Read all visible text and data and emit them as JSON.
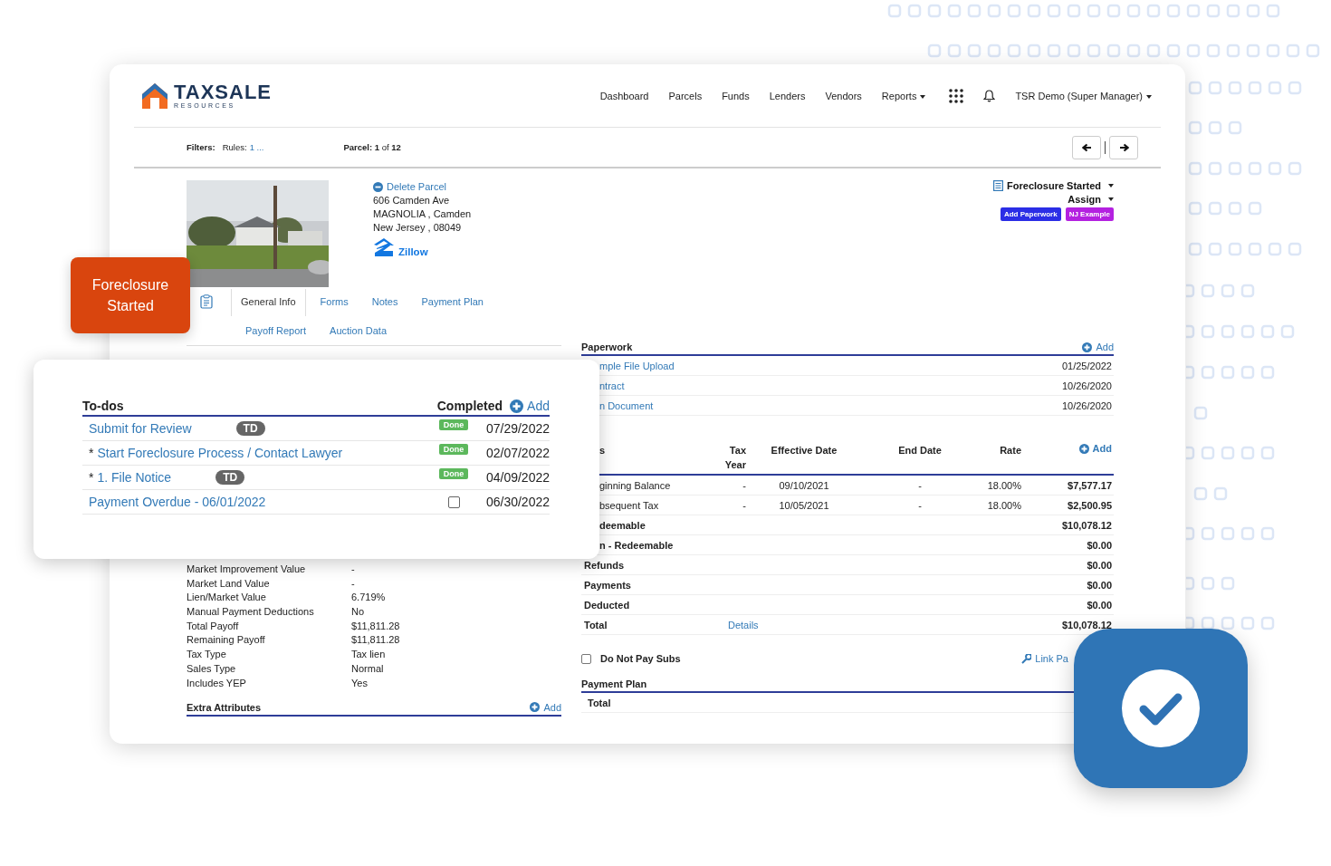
{
  "logo": {
    "name": "TAXSALE",
    "tagline": "RESOURCES"
  },
  "nav": [
    {
      "label": "Dashboard",
      "dropdown": false
    },
    {
      "label": "Parcels",
      "dropdown": false
    },
    {
      "label": "Funds",
      "dropdown": false
    },
    {
      "label": "Lenders",
      "dropdown": false
    },
    {
      "label": "Vendors",
      "dropdown": false
    },
    {
      "label": "Reports",
      "dropdown": true
    }
  ],
  "user": {
    "label": "TSR Demo (Super Manager)"
  },
  "filters": {
    "label": "Filters:",
    "rules_label": "Rules:",
    "rules_value": "1 ...",
    "parcel": "**Parcel:** **1** of **12**"
  },
  "parcel": {
    "delete": "Delete Parcel",
    "address": [
      "606 Camden Ave",
      "MAGNOLIA , Camden",
      "New Jersey , 08049"
    ],
    "zillow": "Zillow"
  },
  "tab_rows": [
    [
      {
        "label": "General Info",
        "selected": true
      },
      {
        "label": "Forms",
        "selected": false
      },
      {
        "label": "Notes",
        "selected": false
      },
      {
        "label": "Payment Plan",
        "selected": false
      }
    ],
    [
      {
        "label": "Payoff Report",
        "selected": false
      },
      {
        "label": "Auction Data",
        "selected": false
      }
    ]
  ],
  "status": {
    "label": "Foreclosure Started",
    "assign": "Assign",
    "buttons": [
      {
        "label": "Add Paperwork",
        "color": "#2b2ee6"
      },
      {
        "label": "NJ Example",
        "color": "#b421e0"
      }
    ]
  },
  "details": [
    {
      "label": "Market Improvement Value",
      "value": "-"
    },
    {
      "label": "Market Land Value",
      "value": "-"
    },
    {
      "label": "Lien/Market Value",
      "value": "6.719%"
    },
    {
      "label": "Manual Payment Deductions",
      "value": "No"
    },
    {
      "label": "Total Payoff",
      "value": "$11,811.28"
    },
    {
      "label": "Remaining Payoff",
      "value": "$11,811.28"
    },
    {
      "label": "Tax Type",
      "value": "Tax lien"
    },
    {
      "label": "Sales Type",
      "value": "Normal"
    },
    {
      "label": "Includes YEP",
      "value": "Yes"
    }
  ],
  "extra_attributes": {
    "title": "Extra Attributes",
    "add": "Add"
  },
  "paperwork": {
    "title": "Paperwork",
    "add": "Add",
    "rows": [
      {
        "name": "mple File Upload",
        "date": "01/25/2022",
        "cut_off": true
      },
      {
        "name": "ntract",
        "date": "10/26/2020",
        "cut_off": true
      },
      {
        "name": "n Document",
        "date": "10/26/2020",
        "cut_off": true
      }
    ]
  },
  "balances": {
    "label_column": {
      "label": "s",
      "cut_off": true
    },
    "columns": [
      "Tax Year",
      "Effective Date",
      "End Date",
      "Rate"
    ],
    "add": "Add",
    "rows": [
      {
        "label": "ginning Balance",
        "cells": [
          "-",
          "09/10/2021",
          "-",
          "18.00%"
        ],
        "amount": "$7,577.17",
        "cut_off": true
      },
      {
        "label": "bsequent Tax",
        "cells": [
          "-",
          "10/05/2021",
          "-",
          "18.00%"
        ],
        "amount": "$2,500.95",
        "cut_off": true
      },
      {
        "label": "deemable",
        "amount": "$10,078.12",
        "cut_off": true
      },
      {
        "label": "n - Redeemable",
        "amount": "$0.00",
        "cut_off": true
      },
      {
        "label": "Refunds",
        "amount": "$0.00",
        "cut_off": false
      },
      {
        "label": "Payments",
        "amount": "$0.00",
        "cut_off": false
      },
      {
        "label": "Deducted",
        "amount": "$0.00",
        "cut_off": false
      },
      {
        "label": "Total",
        "link": "Details",
        "amount": "$10,078.12",
        "cut_off": false
      }
    ]
  },
  "do_not_pay_subs": {
    "label": "Do Not Pay Subs",
    "checked": false
  },
  "link": {
    "label": "Link Pa"
  },
  "payment_plan": {
    "title": "Payment Plan",
    "total": "Total"
  },
  "badge": {
    "label": "Foreclosure Started"
  },
  "todos": {
    "title": "To-dos",
    "completed": "Completed",
    "add": "Add",
    "items": [
      {
        "title": "Submit for Review",
        "tag": "TD",
        "kind": "done",
        "badge": "Done",
        "date": "07/29/2022"
      },
      {
        "marker": "*",
        "title": "Start Foreclosure Process / Contact Lawyer",
        "kind": "done",
        "badge": "Done",
        "date": "02/07/2022"
      },
      {
        "marker": "*",
        "title": "1. File Notice",
        "tag": "TD",
        "kind": "done",
        "badge": "Done",
        "date": "04/09/2022"
      },
      {
        "title": "Payment Overdue - 06/01/2022",
        "kind": "checkbox",
        "checked": false,
        "date": "06/30/2022"
      }
    ]
  }
}
